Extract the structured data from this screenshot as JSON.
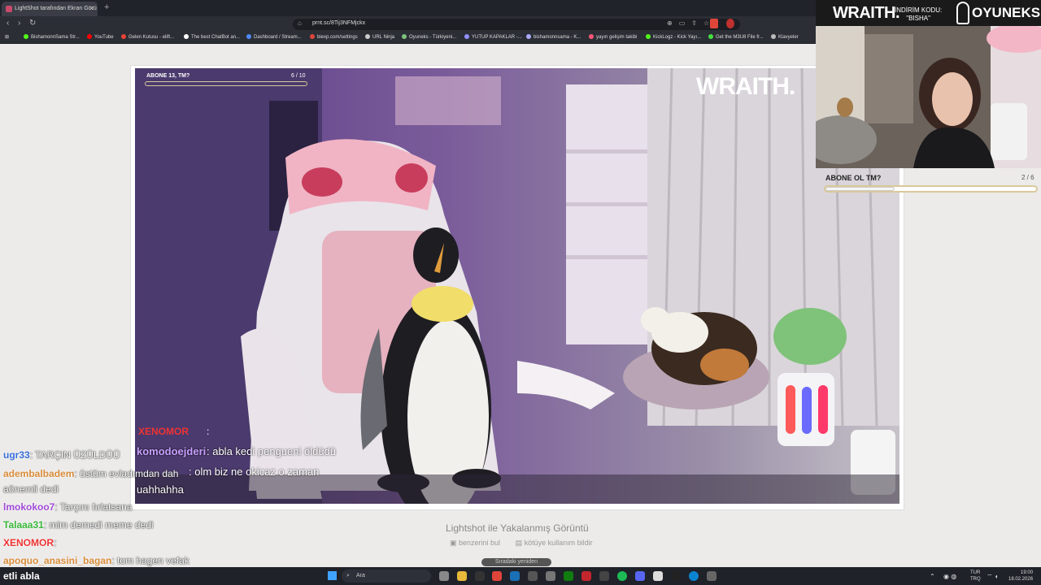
{
  "browser": {
    "tab_title": "LightShot tarafından Ekran Görü",
    "url": "prnt.sc/8Tij3NFMjckx",
    "bookmarks": [
      {
        "label": "BishamonnSama Str...",
        "color": "#53fc18"
      },
      {
        "label": "YouTube",
        "color": "#ff0000"
      },
      {
        "label": "Gelen Kutusu - elift...",
        "color": "#ea4335"
      },
      {
        "label": "The best ChatBot an...",
        "color": "#ffffff"
      },
      {
        "label": "Dashboard / Stream...",
        "color": "#4f8bff"
      },
      {
        "label": "biexp.com/settings",
        "color": "#e0453a"
      },
      {
        "label": "URL Ninja",
        "color": "#cccccc"
      },
      {
        "label": "Oyuneks - Türkiyeni...",
        "color": "#7cc47c"
      },
      {
        "label": "YUTUP KAPAKLAR -...",
        "color": "#9090ff"
      },
      {
        "label": "bishamonnsama - K...",
        "color": "#aaaaff"
      },
      {
        "label": "yayın gelişim takibi",
        "color": "#ff5577"
      },
      {
        "label": "KickLogz - Kick Yayı...",
        "color": "#53fc18"
      },
      {
        "label": "Get the M3U8 File fr...",
        "color": "#44dd44"
      },
      {
        "label": "Klavyeler",
        "color": "#bbbbbb"
      }
    ]
  },
  "screenshot": {
    "sub_goal": "ABONE 13, TM?",
    "sub_count": "6 / 10",
    "watermark": "WRAITH.",
    "chat": [
      {
        "user": "XENOMOR",
        "text": ":",
        "color": "#e33"
      },
      {
        "user": "komodoejderi",
        "text": ": abla kedi pengueni öldüdü",
        "color": "#c8a0ff"
      },
      {
        "user": "",
        "text": ": olm biz ne okicaz o zaman",
        "color": "#fff"
      },
      {
        "user": "",
        "text": "uahhahha",
        "color": "#fff"
      }
    ]
  },
  "page": {
    "caption": "Lightshot ile Yakalanmış Görüntü",
    "link_similar": "benzerini bul",
    "link_report": "kötüye kullanım bildir",
    "pill": "Sıradaki yeniden"
  },
  "overlay": {
    "brand": "WRAITH.",
    "promo_line1": "İNDİRİM KODU:",
    "promo_line2": "\"BISHA\"",
    "sponsor": "OYUNEKS",
    "goal_label": "ABONE OL TM?",
    "goal_count": "2 / 6",
    "goal_progress": 0.33
  },
  "chat": [
    {
      "user": "ugr33",
      "text": ": TARÇIN ÜZÜLDÜÜ",
      "color": "#3a6fd8"
    },
    {
      "user": "adembalbadem",
      "text": ": üstüm evladımdan dah",
      "color": "#d98c3a"
    },
    {
      "user": "",
      "text": "aönemli dedi",
      "color": "#fff"
    },
    {
      "user": "lmokokoo7",
      "text": ": Tarçını fırlatsana",
      "color": "#a04ad8"
    },
    {
      "user": "Talaaa31",
      "text": ": mim demedi meme dedi",
      "color": "#3ab83a"
    },
    {
      "user": "XENOMOR",
      "text": ":",
      "color": "#e33"
    },
    {
      "user": "apoquo_anasini_bagan",
      "text": ": tom hagen vefak",
      "color": "#d98c3a"
    }
  ],
  "bottom_chat_text": "etli abla",
  "taskbar": {
    "search_placeholder": "Ara",
    "lang_line1": "TUR",
    "lang_line2": "TRQ",
    "time": "19:00",
    "date": "18.02.2026"
  }
}
